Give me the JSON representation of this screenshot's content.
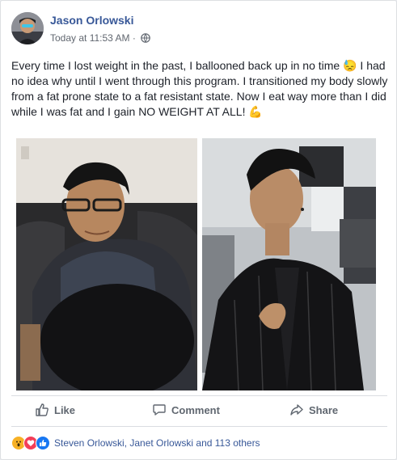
{
  "post": {
    "author": "Jason Orlowski",
    "timestamp": "Today at 11:53 AM",
    "separator": "·",
    "privacy_icon": "globe-icon",
    "text_before_emoji": "Every time I lost weight in the past, I ballooned back up in no time ",
    "emoji_1": "😓",
    "text_middle": " I had no idea why until I went through this program. I transitioned my body slowly from a fat prone state to a fat resistant state. Now I eat way more than I did while I was fat and I gain NO WEIGHT AT ALL! ",
    "emoji_2": "💪"
  },
  "photos": [
    {
      "name": "before-photo"
    },
    {
      "name": "after-photo"
    }
  ],
  "actions": {
    "like_label": "Like",
    "comment_label": "Comment",
    "share_label": "Share"
  },
  "reactions": {
    "icons": [
      "wow-reaction-icon",
      "love-reaction-icon",
      "like-reaction-icon"
    ],
    "summary": "Steven Orlowski, Janet Orlowski and 113 others"
  },
  "colors": {
    "link": "#385898",
    "muted": "#616770",
    "like_blue": "#1877f2",
    "love_red": "#f33e58",
    "wow_yellow": "#f7b125"
  }
}
